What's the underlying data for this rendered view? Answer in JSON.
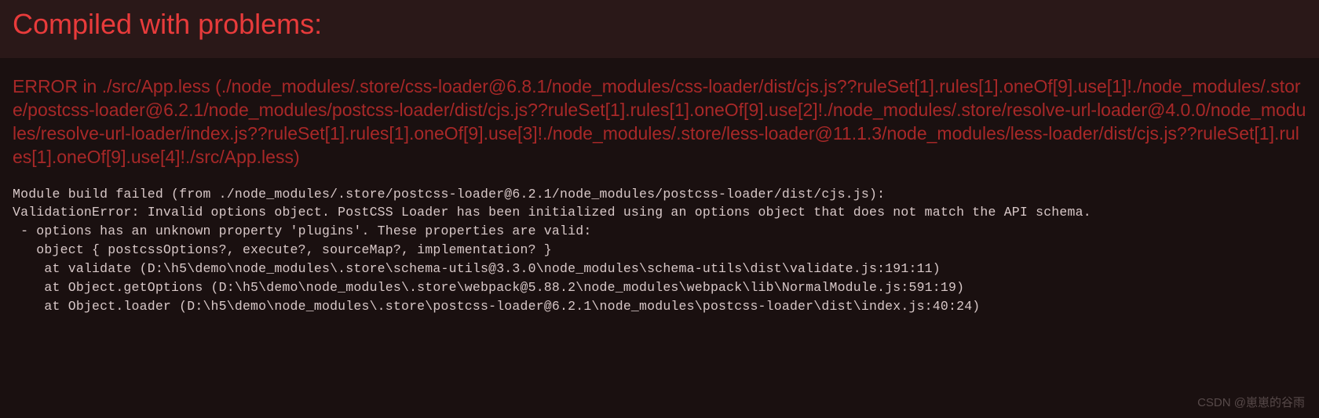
{
  "header": {
    "title": "Compiled with problems:"
  },
  "error": {
    "heading": "ERROR in ./src/App.less (./node_modules/.store/css-loader@6.8.1/node_modules/css-loader/dist/cjs.js??ruleSet[1].rules[1].oneOf[9].use[1]!./node_modules/.store/postcss-loader@6.2.1/node_modules/postcss-loader/dist/cjs.js??ruleSet[1].rules[1].oneOf[9].use[2]!./node_modules/.store/resolve-url-loader@4.0.0/node_modules/resolve-url-loader/index.js??ruleSet[1].rules[1].oneOf[9].use[3]!./node_modules/.store/less-loader@11.1.3/node_modules/less-loader/dist/cjs.js??ruleSet[1].rules[1].oneOf[9].use[4]!./src/App.less)",
    "stack": "Module build failed (from ./node_modules/.store/postcss-loader@6.2.1/node_modules/postcss-loader/dist/cjs.js):\nValidationError: Invalid options object. PostCSS Loader has been initialized using an options object that does not match the API schema.\n - options has an unknown property 'plugins'. These properties are valid:\n   object { postcssOptions?, execute?, sourceMap?, implementation? }\n    at validate (D:\\h5\\demo\\node_modules\\.store\\schema-utils@3.3.0\\node_modules\\schema-utils\\dist\\validate.js:191:11)\n    at Object.getOptions (D:\\h5\\demo\\node_modules\\.store\\webpack@5.88.2\\node_modules\\webpack\\lib\\NormalModule.js:591:19)\n    at Object.loader (D:\\h5\\demo\\node_modules\\.store\\postcss-loader@6.2.1\\node_modules\\postcss-loader\\dist\\index.js:40:24)"
  },
  "watermark": {
    "text": "CSDN @崽崽的谷雨"
  }
}
